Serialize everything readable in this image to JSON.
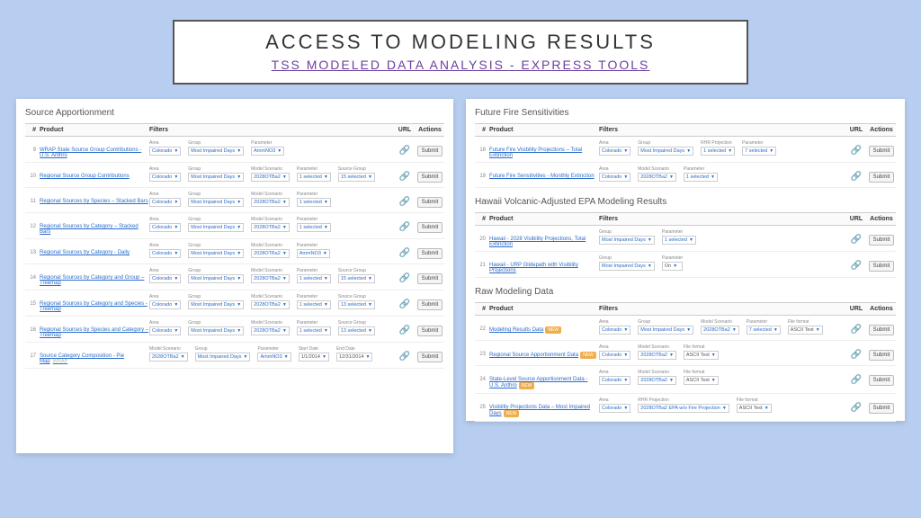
{
  "title": {
    "main": "ACCESS TO MODELING RESULTS",
    "sub": "TSS MODELED DATA ANALYSIS - EXPRESS TOOLS"
  },
  "headers": {
    "num": "#",
    "product": "Product",
    "filters": "Filters",
    "url": "URL",
    "actions": "Actions"
  },
  "labels": {
    "submit": "Submit",
    "new": "NEW"
  },
  "filter_labels": {
    "area": "Area",
    "group": "Group",
    "parameter": "Parameter",
    "model_scenario": "Model Scenario",
    "source_group": "Source Group",
    "start_date": "Start Date",
    "end_date": "End Date",
    "rhr_projection": "RHR Projection",
    "file_format": "File format"
  },
  "filter_values": {
    "colorado": "Colorado",
    "most_impaired": "Most Impaired Days",
    "ammno3": "AmmNO3",
    "scenario": "2028OTBa2",
    "one_selected": "1 selected",
    "seven_selected": "7 selected",
    "thirteen_selected": "13 selected",
    "fifteen_selected": "15 selected",
    "on": "On",
    "date1": "1/1/2014",
    "date2": "12/31/2014",
    "ascii": "ASCII Text",
    "fire_proj": "2028OTBa2 EPA w/o Fire Projection"
  },
  "left": {
    "section": "Source Apportionment",
    "rows": [
      {
        "num": "9",
        "product": "WRAP State Source Group Contributions - U.S. Anthro",
        "filters": [
          "area",
          "group",
          "parameter"
        ]
      },
      {
        "num": "10",
        "product": "Regional Source Group Contributions",
        "filters": [
          "area",
          "group",
          "model_scenario",
          "parameter",
          "source_group"
        ],
        "sel": [
          "one_selected",
          "fifteen_selected"
        ]
      },
      {
        "num": "11",
        "product": "Regional Sources by Species – Stacked Bars",
        "filters": [
          "area",
          "group",
          "model_scenario",
          "parameter"
        ],
        "sel": [
          "one_selected"
        ]
      },
      {
        "num": "12",
        "product": "Regional Sources by Category – Stacked Bars",
        "filters": [
          "area",
          "group",
          "model_scenario",
          "parameter"
        ],
        "sel": [
          "one_selected"
        ]
      },
      {
        "num": "13",
        "product": "Regional Sources by Category - Daily",
        "filters": [
          "area",
          "group",
          "model_scenario",
          "parameter"
        ]
      },
      {
        "num": "14",
        "product": "Regional Sources by Category and Group – Treemap",
        "filters": [
          "area",
          "group",
          "model_scenario",
          "parameter",
          "source_group"
        ],
        "sel": [
          "one_selected",
          "fifteen_selected"
        ]
      },
      {
        "num": "15",
        "product": "Regional Sources by Category and Species - Treemap",
        "filters": [
          "area",
          "group",
          "model_scenario",
          "parameter",
          "source_group"
        ],
        "sel": [
          "one_selected",
          "thirteen_selected"
        ]
      },
      {
        "num": "16",
        "product": "Regional Sources by Species and Category – Treemap",
        "filters": [
          "area",
          "group",
          "model_scenario",
          "parameter",
          "source_group"
        ],
        "sel": [
          "one_selected",
          "thirteen_selected"
        ]
      },
      {
        "num": "17",
        "product": "Source Category Composition - Pie Map",
        "wrap": "WRAP",
        "filters": [
          "model_scenario",
          "group",
          "parameter",
          "start_date",
          "end_date"
        ]
      }
    ]
  },
  "right": {
    "sections": [
      {
        "title": "Future Fire Sensitivities",
        "rows": [
          {
            "num": "18",
            "product": "Future Fire Visibility Projections – Total Extinction",
            "filters": [
              "area",
              "group",
              "rhr_projection",
              "parameter"
            ],
            "sel": [
              "one_selected",
              "seven_selected"
            ]
          },
          {
            "num": "19",
            "product": "Future Fire Sensitivities - Monthly Extinction",
            "filters": [
              "area",
              "model_scenario",
              "parameter"
            ],
            "sel": [
              "one_selected",
              "seven_selected"
            ]
          }
        ]
      },
      {
        "title": "Hawaii Volcanic-Adjusted EPA Modeling Results",
        "rows": [
          {
            "num": "20",
            "product": "Hawaii - 2028 Visibility Projections, Total Extinction",
            "filters": [
              "group",
              "parameter"
            ],
            "sel": [
              "one_selected"
            ]
          },
          {
            "num": "21",
            "product": "Hawaii - URP Glidepath with Visibility Projections",
            "filters": [
              "group",
              "parameter"
            ],
            "on": true
          }
        ]
      },
      {
        "title": "Raw Modeling Data",
        "rows": [
          {
            "num": "22",
            "product": "Modeling Results Data",
            "new": true,
            "filters": [
              "area",
              "group",
              "model_scenario",
              "parameter",
              "file_format"
            ],
            "sel": [
              "seven_selected"
            ]
          },
          {
            "num": "23",
            "product": "Regional Source Apportionment Data",
            "new": true,
            "filters": [
              "area",
              "model_scenario",
              "file_format"
            ]
          },
          {
            "num": "24",
            "product": "State-Level Source Apportionment Data - U.S. Anthro",
            "new": true,
            "filters": [
              "area",
              "model_scenario",
              "file_format"
            ]
          },
          {
            "num": "25",
            "product": "Visibility Projections Data – Most Impaired Days",
            "new": true,
            "filters": [
              "area",
              "rhr_projection",
              "file_format"
            ],
            "fire": true
          }
        ]
      }
    ]
  }
}
